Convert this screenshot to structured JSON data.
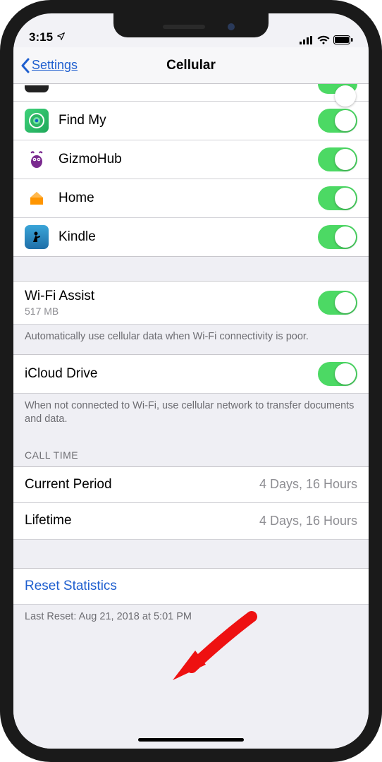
{
  "status": {
    "time": "3:15"
  },
  "nav": {
    "back": "Settings",
    "title": "Cellular"
  },
  "apps": {
    "items": [
      {
        "label": ""
      },
      {
        "label": "Find My"
      },
      {
        "label": "GizmoHub"
      },
      {
        "label": "Home"
      },
      {
        "label": "Kindle"
      }
    ]
  },
  "wifiAssist": {
    "title": "Wi-Fi Assist",
    "sub": "517 MB",
    "footer": "Automatically use cellular data when Wi-Fi connectivity is poor."
  },
  "icloudDrive": {
    "title": "iCloud Drive",
    "footer": "When not connected to Wi-Fi, use cellular network to transfer documents and data."
  },
  "callTime": {
    "header": "CALL TIME",
    "currentLabel": "Current Period",
    "currentValue": "4 Days, 16 Hours",
    "lifetimeLabel": "Lifetime",
    "lifetimeValue": "4 Days, 16 Hours"
  },
  "reset": {
    "label": "Reset Statistics",
    "footer": "Last Reset: Aug 21, 2018 at 5:01 PM"
  }
}
